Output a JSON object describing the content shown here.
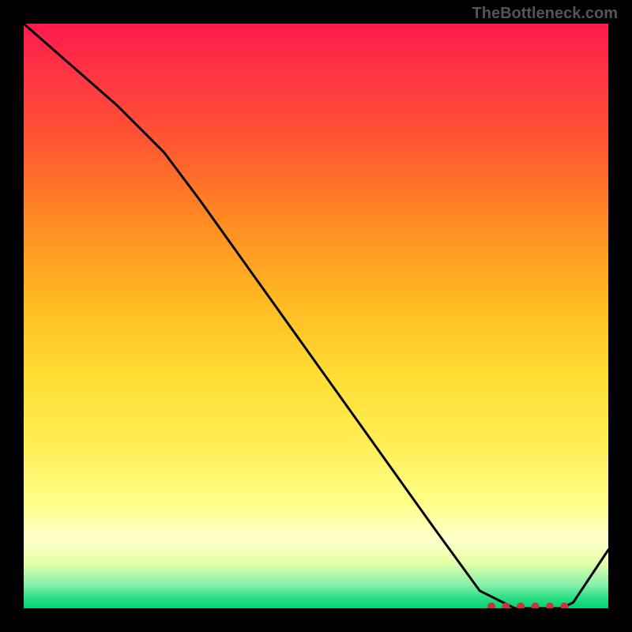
{
  "watermark": "TheBottleneck.com",
  "chart_data": {
    "type": "line",
    "title": "",
    "xlabel": "",
    "ylabel": "",
    "xlim": [
      0,
      100
    ],
    "ylim": [
      0,
      100
    ],
    "x": [
      0,
      8,
      16,
      24,
      30,
      40,
      50,
      60,
      70,
      78,
      84,
      88,
      92,
      94,
      100
    ],
    "values": [
      100,
      93,
      86,
      78,
      70,
      56,
      42,
      28,
      14,
      3,
      0,
      0,
      0,
      1,
      10
    ],
    "annotations": []
  }
}
